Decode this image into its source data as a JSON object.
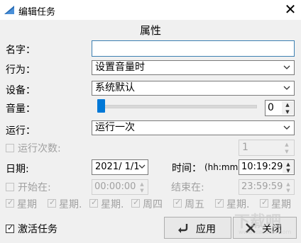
{
  "window": {
    "title": "编辑任务",
    "close_label": "✕"
  },
  "section_title": "属性",
  "name": {
    "label": "名字：",
    "value": ""
  },
  "behavior": {
    "label": "行为：",
    "value": "设置音量时"
  },
  "device": {
    "label": "设备：",
    "value": "系统默认"
  },
  "volume": {
    "label": "音量：",
    "value": "0",
    "level": 0
  },
  "run": {
    "label": "运行：",
    "value": "运行一次"
  },
  "run_count": {
    "label": "运行次数:",
    "value": "1"
  },
  "date": {
    "label": "日期:",
    "value": "2021/  1/1"
  },
  "time": {
    "label": "时间：",
    "format_label": "(hh:mm",
    "value": "10:19:29"
  },
  "start": {
    "label": "开始在:",
    "value": "00:00:00"
  },
  "end": {
    "label": "结束在:",
    "value": "23:59:59"
  },
  "weekdays": [
    {
      "label": "星期"
    },
    {
      "label": "星期."
    },
    {
      "label": "星期."
    },
    {
      "label": "周四"
    },
    {
      "label": "周五"
    },
    {
      "label": "星期."
    },
    {
      "label": "星期"
    }
  ],
  "activate": {
    "label": "激活任务",
    "checked": true
  },
  "buttons": {
    "apply": "应用",
    "close": "关闭"
  },
  "watermark": {
    "main": "下载吧",
    "sub": "www.xiazaiba.com"
  },
  "colors": {
    "accent": "#0078d7",
    "focus_border": "#3c7fb1"
  },
  "icons": [
    "app-icon",
    "close-icon",
    "chevron-down-icon",
    "spin-icon",
    "check-icon",
    "apply-icon",
    "close-button-icon"
  ]
}
